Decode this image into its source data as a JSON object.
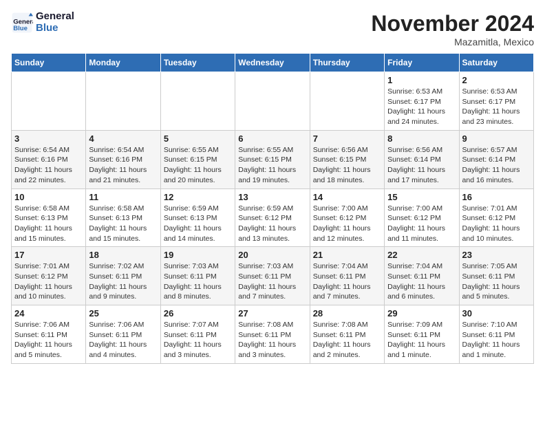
{
  "header": {
    "logo_general": "General",
    "logo_blue": "Blue",
    "month_title": "November 2024",
    "location": "Mazamitla, Mexico"
  },
  "days_of_week": [
    "Sunday",
    "Monday",
    "Tuesday",
    "Wednesday",
    "Thursday",
    "Friday",
    "Saturday"
  ],
  "weeks": [
    [
      {
        "day": "",
        "info": ""
      },
      {
        "day": "",
        "info": ""
      },
      {
        "day": "",
        "info": ""
      },
      {
        "day": "",
        "info": ""
      },
      {
        "day": "",
        "info": ""
      },
      {
        "day": "1",
        "info": "Sunrise: 6:53 AM\nSunset: 6:17 PM\nDaylight: 11 hours and 24 minutes."
      },
      {
        "day": "2",
        "info": "Sunrise: 6:53 AM\nSunset: 6:17 PM\nDaylight: 11 hours and 23 minutes."
      }
    ],
    [
      {
        "day": "3",
        "info": "Sunrise: 6:54 AM\nSunset: 6:16 PM\nDaylight: 11 hours and 22 minutes."
      },
      {
        "day": "4",
        "info": "Sunrise: 6:54 AM\nSunset: 6:16 PM\nDaylight: 11 hours and 21 minutes."
      },
      {
        "day": "5",
        "info": "Sunrise: 6:55 AM\nSunset: 6:15 PM\nDaylight: 11 hours and 20 minutes."
      },
      {
        "day": "6",
        "info": "Sunrise: 6:55 AM\nSunset: 6:15 PM\nDaylight: 11 hours and 19 minutes."
      },
      {
        "day": "7",
        "info": "Sunrise: 6:56 AM\nSunset: 6:15 PM\nDaylight: 11 hours and 18 minutes."
      },
      {
        "day": "8",
        "info": "Sunrise: 6:56 AM\nSunset: 6:14 PM\nDaylight: 11 hours and 17 minutes."
      },
      {
        "day": "9",
        "info": "Sunrise: 6:57 AM\nSunset: 6:14 PM\nDaylight: 11 hours and 16 minutes."
      }
    ],
    [
      {
        "day": "10",
        "info": "Sunrise: 6:58 AM\nSunset: 6:13 PM\nDaylight: 11 hours and 15 minutes."
      },
      {
        "day": "11",
        "info": "Sunrise: 6:58 AM\nSunset: 6:13 PM\nDaylight: 11 hours and 15 minutes."
      },
      {
        "day": "12",
        "info": "Sunrise: 6:59 AM\nSunset: 6:13 PM\nDaylight: 11 hours and 14 minutes."
      },
      {
        "day": "13",
        "info": "Sunrise: 6:59 AM\nSunset: 6:12 PM\nDaylight: 11 hours and 13 minutes."
      },
      {
        "day": "14",
        "info": "Sunrise: 7:00 AM\nSunset: 6:12 PM\nDaylight: 11 hours and 12 minutes."
      },
      {
        "day": "15",
        "info": "Sunrise: 7:00 AM\nSunset: 6:12 PM\nDaylight: 11 hours and 11 minutes."
      },
      {
        "day": "16",
        "info": "Sunrise: 7:01 AM\nSunset: 6:12 PM\nDaylight: 11 hours and 10 minutes."
      }
    ],
    [
      {
        "day": "17",
        "info": "Sunrise: 7:01 AM\nSunset: 6:12 PM\nDaylight: 11 hours and 10 minutes."
      },
      {
        "day": "18",
        "info": "Sunrise: 7:02 AM\nSunset: 6:11 PM\nDaylight: 11 hours and 9 minutes."
      },
      {
        "day": "19",
        "info": "Sunrise: 7:03 AM\nSunset: 6:11 PM\nDaylight: 11 hours and 8 minutes."
      },
      {
        "day": "20",
        "info": "Sunrise: 7:03 AM\nSunset: 6:11 PM\nDaylight: 11 hours and 7 minutes."
      },
      {
        "day": "21",
        "info": "Sunrise: 7:04 AM\nSunset: 6:11 PM\nDaylight: 11 hours and 7 minutes."
      },
      {
        "day": "22",
        "info": "Sunrise: 7:04 AM\nSunset: 6:11 PM\nDaylight: 11 hours and 6 minutes."
      },
      {
        "day": "23",
        "info": "Sunrise: 7:05 AM\nSunset: 6:11 PM\nDaylight: 11 hours and 5 minutes."
      }
    ],
    [
      {
        "day": "24",
        "info": "Sunrise: 7:06 AM\nSunset: 6:11 PM\nDaylight: 11 hours and 5 minutes."
      },
      {
        "day": "25",
        "info": "Sunrise: 7:06 AM\nSunset: 6:11 PM\nDaylight: 11 hours and 4 minutes."
      },
      {
        "day": "26",
        "info": "Sunrise: 7:07 AM\nSunset: 6:11 PM\nDaylight: 11 hours and 3 minutes."
      },
      {
        "day": "27",
        "info": "Sunrise: 7:08 AM\nSunset: 6:11 PM\nDaylight: 11 hours and 3 minutes."
      },
      {
        "day": "28",
        "info": "Sunrise: 7:08 AM\nSunset: 6:11 PM\nDaylight: 11 hours and 2 minutes."
      },
      {
        "day": "29",
        "info": "Sunrise: 7:09 AM\nSunset: 6:11 PM\nDaylight: 11 hours and 1 minute."
      },
      {
        "day": "30",
        "info": "Sunrise: 7:10 AM\nSunset: 6:11 PM\nDaylight: 11 hours and 1 minute."
      }
    ]
  ]
}
